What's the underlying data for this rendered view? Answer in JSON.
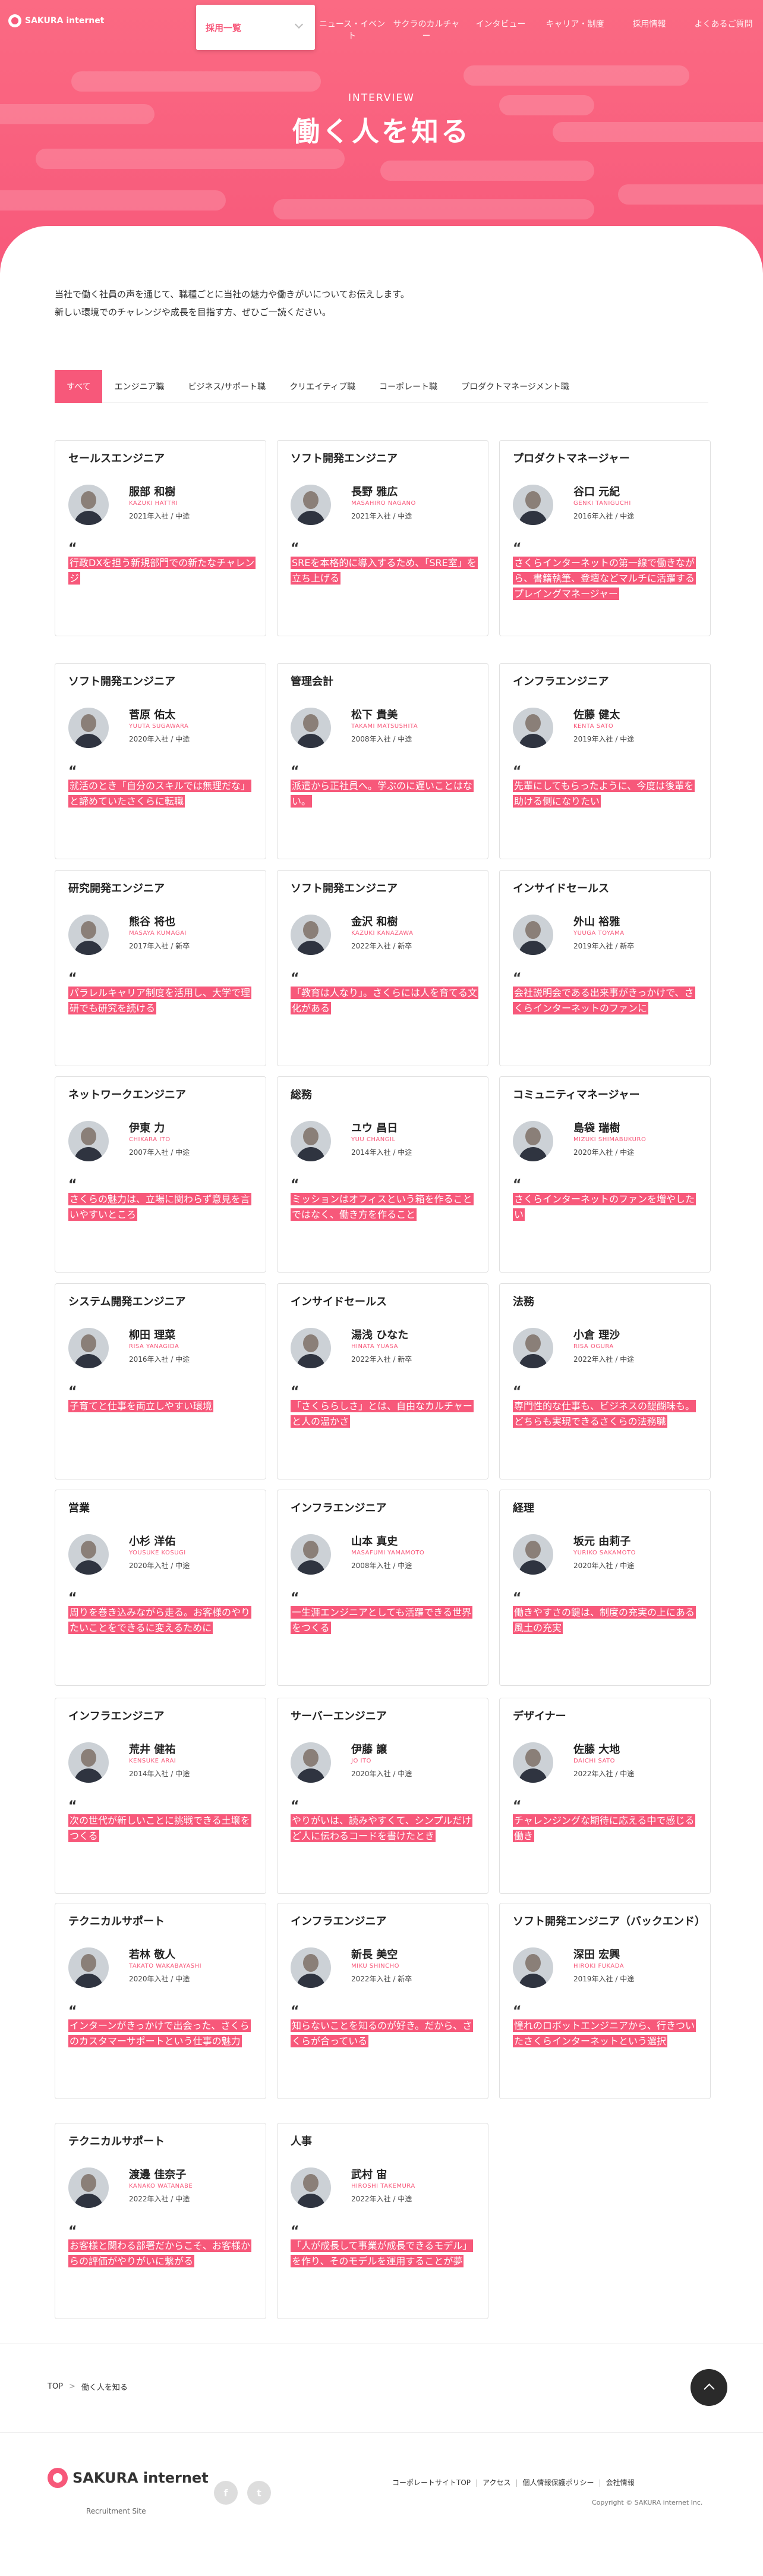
{
  "header": {
    "logo_text": "SAKURA internet",
    "dropdown_label": "採用一覧",
    "nav_items": [
      "ニュース・イベント",
      "サクラのカルチャー",
      "インタビュー",
      "キャリア・制度",
      "採用情報",
      "よくあるご質問"
    ],
    "label": "INTERVIEW",
    "title": "働く人を知る"
  },
  "intro": {
    "line1": "当社で働く社員の声を通じて、職種ごとに当社の魅力や働きがいについてお伝えします。",
    "line2": "新しい環境でのチャレンジや成長を目指す方、ぜひご一読ください。"
  },
  "tabs": [
    "すべて",
    "エンジニア職",
    "ビジネス/サポート職",
    "クリエイティブ職",
    "コーポレート職",
    "プロダクトマネージメント職"
  ],
  "cards": [
    {
      "job": "セールスエンジニア",
      "name": "服部 和樹",
      "roman": "KAZUKI HATTRI",
      "year": "2021年入社 / 中途",
      "quote": "行政DXを担う新規部門での新たなチャレンジ"
    },
    {
      "job": "ソフト開発エンジニア",
      "name": "長野 雅広",
      "roman": "MASAHIRO NAGANO",
      "year": "2021年入社 / 中途",
      "quote": "SREを本格的に導入するため、「SRE室」を立ち上げる"
    },
    {
      "job": "プロダクトマネージャー",
      "name": "谷口 元紀",
      "roman": "GENKI TANIGUCHI",
      "year": "2016年入社 / 中途",
      "quote": "さくらインターネットの第一線で働きながら、書籍執筆、登壇などマルチに活躍するプレイングマネージャー"
    },
    {
      "job": "ソフト開発エンジニア",
      "name": "菅原 佑太",
      "roman": "YUUTA SUGAWARA",
      "year": "2020年入社 / 中途",
      "quote": "就活のとき「自分のスキルでは無理だな」と諦めていたさくらに転職"
    },
    {
      "job": "管理会計",
      "name": "松下 貴美",
      "roman": "TAKAMI MATSUSHITA",
      "year": "2008年入社 / 中途",
      "quote": "派遣から正社員へ。学ぶのに遅いことはない。"
    },
    {
      "job": "インフラエンジニア",
      "name": "佐藤 健太",
      "roman": "KENTA SATO",
      "year": "2019年入社 / 中途",
      "quote": "先輩にしてもらったように、今度は後輩を助ける側になりたい"
    },
    {
      "job": "研究開発エンジニア",
      "name": "熊谷 将也",
      "roman": "MASAYA KUMAGAI",
      "year": "2017年入社 / 新卒",
      "quote": "パラレルキャリア制度を活用し、大学で理研でも研究を続ける"
    },
    {
      "job": "ソフト開発エンジニア",
      "name": "金沢 和樹",
      "roman": "KAZUKI KANAZAWA",
      "year": "2022年入社 / 新卒",
      "quote": "「教育は人なり」。さくらには人を育てる文化がある"
    },
    {
      "job": "インサイドセールス",
      "name": "外山 裕雅",
      "roman": "YUUGA TOYAMA",
      "year": "2019年入社 / 新卒",
      "quote": "会社説明会である出来事がきっかけで、さくらインターネットのファンに"
    },
    {
      "job": "ネットワークエンジニア",
      "name": "伊東 力",
      "roman": "CHIKARA ITO",
      "year": "2007年入社 / 中途",
      "quote": "さくらの魅力は、立場に関わらず意見を言いやすいところ"
    },
    {
      "job": "総務",
      "name": "ユウ 昌日",
      "roman": "YUU CHANGIL",
      "year": "2014年入社 / 中途",
      "quote": "ミッションはオフィスという箱を作ることではなく、働き方を作ること"
    },
    {
      "job": "コミュニティマネージャー",
      "name": "島袋 瑞樹",
      "roman": "MIZUKI SHIMABUKURO",
      "year": "2020年入社 / 中途",
      "quote": "さくらインターネットのファンを増やしたい"
    },
    {
      "job": "システム開発エンジニア",
      "name": "柳田 理菜",
      "roman": "RISA YANAGIDA",
      "year": "2016年入社 / 中途",
      "quote": "子育てと仕事を両立しやすい環境"
    },
    {
      "job": "インサイドセールス",
      "name": "湯浅 ひなた",
      "roman": "HINATA YUASA",
      "year": "2022年入社 / 新卒",
      "quote": "「さくららしさ」とは、自由なカルチャーと人の温かさ"
    },
    {
      "job": "法務",
      "name": "小倉 理沙",
      "roman": "RISA OGURA",
      "year": "2022年入社 / 中途",
      "quote": "専門性的な仕事も、ビジネスの醍醐味も。どちらも実現できるさくらの法務職"
    },
    {
      "job": "営業",
      "name": "小杉 洋佑",
      "roman": "YOUSUKE KOSUGI",
      "year": "2020年入社 / 中途",
      "quote": "周りを巻き込みながら走る。お客様のやりたいことをできるに変えるために"
    },
    {
      "job": "インフラエンジニア",
      "name": "山本 真史",
      "roman": "MASAFUMI YAMAMOTO",
      "year": "2008年入社 / 中途",
      "quote": "一生涯エンジニアとしても活躍できる世界をつくる"
    },
    {
      "job": "経理",
      "name": "坂元 由莉子",
      "roman": "YURIKO SAKAMOTO",
      "year": "2020年入社 / 中途",
      "quote": "働きやすさの鍵は、制度の充実の上にある風土の充実"
    },
    {
      "job": "インフラエンジニア",
      "name": "荒井 健祐",
      "roman": "KENSUKE ARAI",
      "year": "2014年入社 / 中途",
      "quote": "次の世代が新しいことに挑戦できる土壌をつくる"
    },
    {
      "job": "サーバーエンジニア",
      "name": "伊藤 譲",
      "roman": "JO ITO",
      "year": "2020年入社 / 中途",
      "quote": "やりがいは、読みやすくて、シンプルだけど人に伝わるコードを書けたとき"
    },
    {
      "job": "デザイナー",
      "name": "佐藤 大地",
      "roman": "DAICHI SATO",
      "year": "2022年入社 / 中途",
      "quote": "チャレンジングな期待に応える中で感じる働き"
    },
    {
      "job": "テクニカルサポート",
      "name": "若林 敬人",
      "roman": "TAKATO WAKABAYASHI",
      "year": "2020年入社 / 中途",
      "quote": "インターンがきっかけで出会った、さくらのカスタマーサポートという仕事の魅力"
    },
    {
      "job": "インフラエンジニア",
      "name": "新長 美空",
      "roman": "MIKU SHINCHO",
      "year": "2022年入社 / 新卒",
      "quote": "知らないことを知るのが好き。だから、さくらが合っている"
    },
    {
      "job": "ソフト開発エンジニア（バックエンド）",
      "name": "深田 宏興",
      "roman": "HIROKI FUKADA",
      "year": "2019年入社 / 中途",
      "quote": "憧れのロボットエンジニアから、行きついたさくらインターネットという選択"
    },
    {
      "job": "テクニカルサポート",
      "name": "渡邊 佳奈子",
      "roman": "KANAKO WATANABE",
      "year": "2022年入社 / 中途",
      "quote": "お客様と関わる部署だからこそ、お客様からの評価がやりがいに繋がる"
    },
    {
      "job": "人事",
      "name": "武村 宙",
      "roman": "HIROSHI TAKEMURA",
      "year": "2022年入社 / 中途",
      "quote": "「人が成長して事業が成長できるモデル」を作り、そのモデルを運用することが夢"
    }
  ],
  "breadcrumb": [
    "TOP",
    "働く人を知る"
  ],
  "footer": {
    "logo_text": "SAKURA internet",
    "sub": "Recruitment Site",
    "social": [
      "f",
      "t"
    ],
    "links": [
      "コーポレートサイトTOP",
      "アクセス",
      "個人情報保護ポリシー",
      "会社情報"
    ],
    "copyright": "Copyright © SAKURA internet Inc."
  },
  "colors": {
    "accent": "#f7587a"
  }
}
